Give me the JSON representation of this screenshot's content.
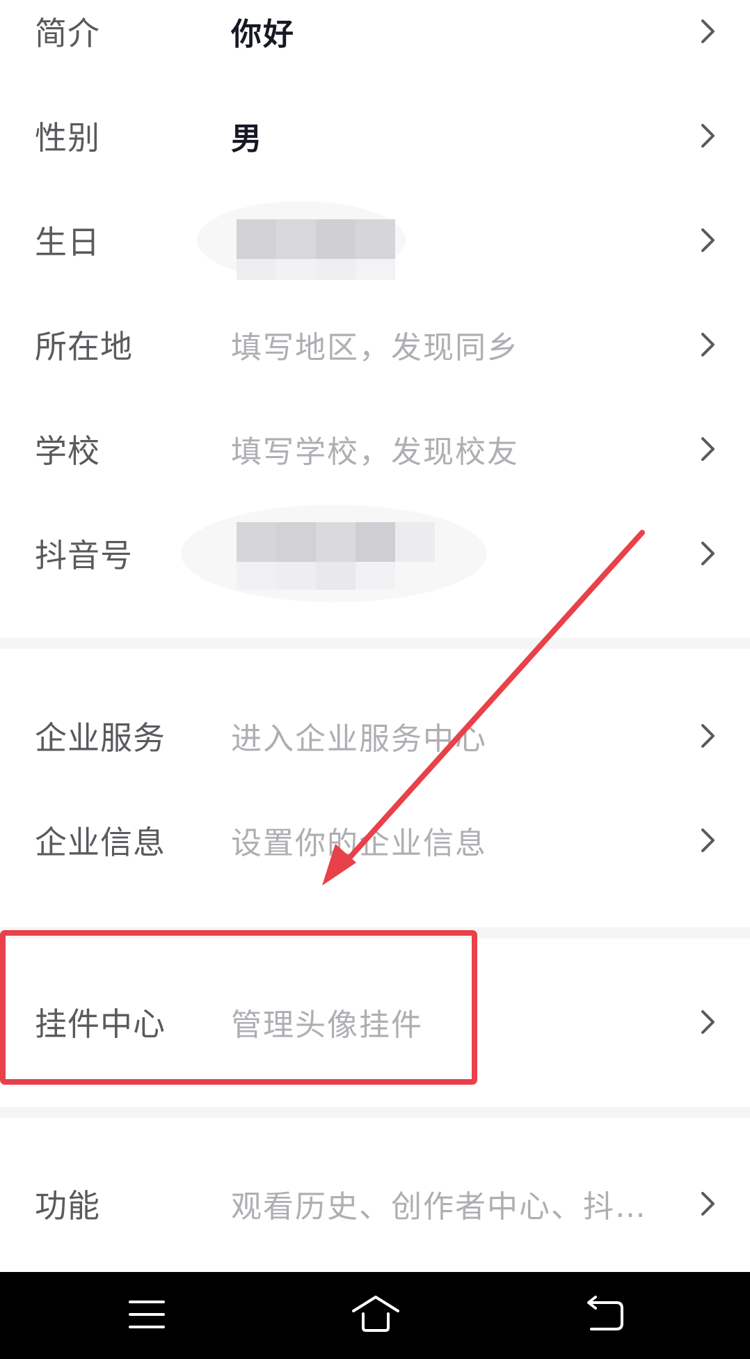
{
  "rows": [
    {
      "label": "简介",
      "value": "你好"
    },
    {
      "label": "性别",
      "value": "男"
    },
    {
      "label": "生日",
      "value": ""
    },
    {
      "label": "所在地",
      "value": "填写地区，发现同乡"
    },
    {
      "label": "学校",
      "value": "填写学校，发现校友"
    },
    {
      "label": "抖音号",
      "value": ""
    },
    {
      "label": "企业服务",
      "value": "进入企业服务中心"
    },
    {
      "label": "企业信息",
      "value": "设置你的企业信息"
    },
    {
      "label": "挂件中心",
      "value": "管理头像挂件"
    },
    {
      "label": "功能",
      "value": "观看历史、创作者中心、抖…"
    }
  ],
  "icons": {
    "chevron": "chevron-right-icon",
    "nav_menu": "menu-icon",
    "nav_home": "home-icon",
    "nav_back": "back-icon"
  },
  "annotation": {
    "highlight_color": "#e8414a",
    "highlighted_row": "挂件中心"
  },
  "colors": {
    "label": "#5a5a5e",
    "value_strong": "#161823",
    "value_hint": "#aeaeb3",
    "divider": "#f5f5f5",
    "navbar": "#000000"
  }
}
